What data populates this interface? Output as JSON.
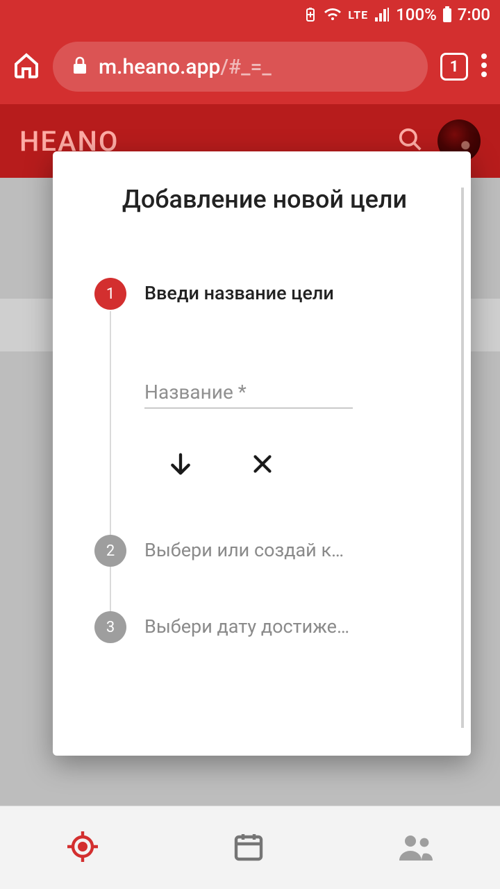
{
  "status": {
    "battery_pct": "100%",
    "time": "7:00",
    "net": "LTE"
  },
  "browser": {
    "host": "m.heano.app",
    "path": "/#_=_",
    "tab_count": "1"
  },
  "app": {
    "title": "HEANO"
  },
  "modal": {
    "title": "Добавление новой цели",
    "steps": [
      {
        "num": "1",
        "label": "Введи название цели"
      },
      {
        "num": "2",
        "label": "Выбери или создай к…"
      },
      {
        "num": "3",
        "label": "Выбери дату достиже…"
      }
    ],
    "name_input": {
      "placeholder": "Название *",
      "value": ""
    }
  }
}
